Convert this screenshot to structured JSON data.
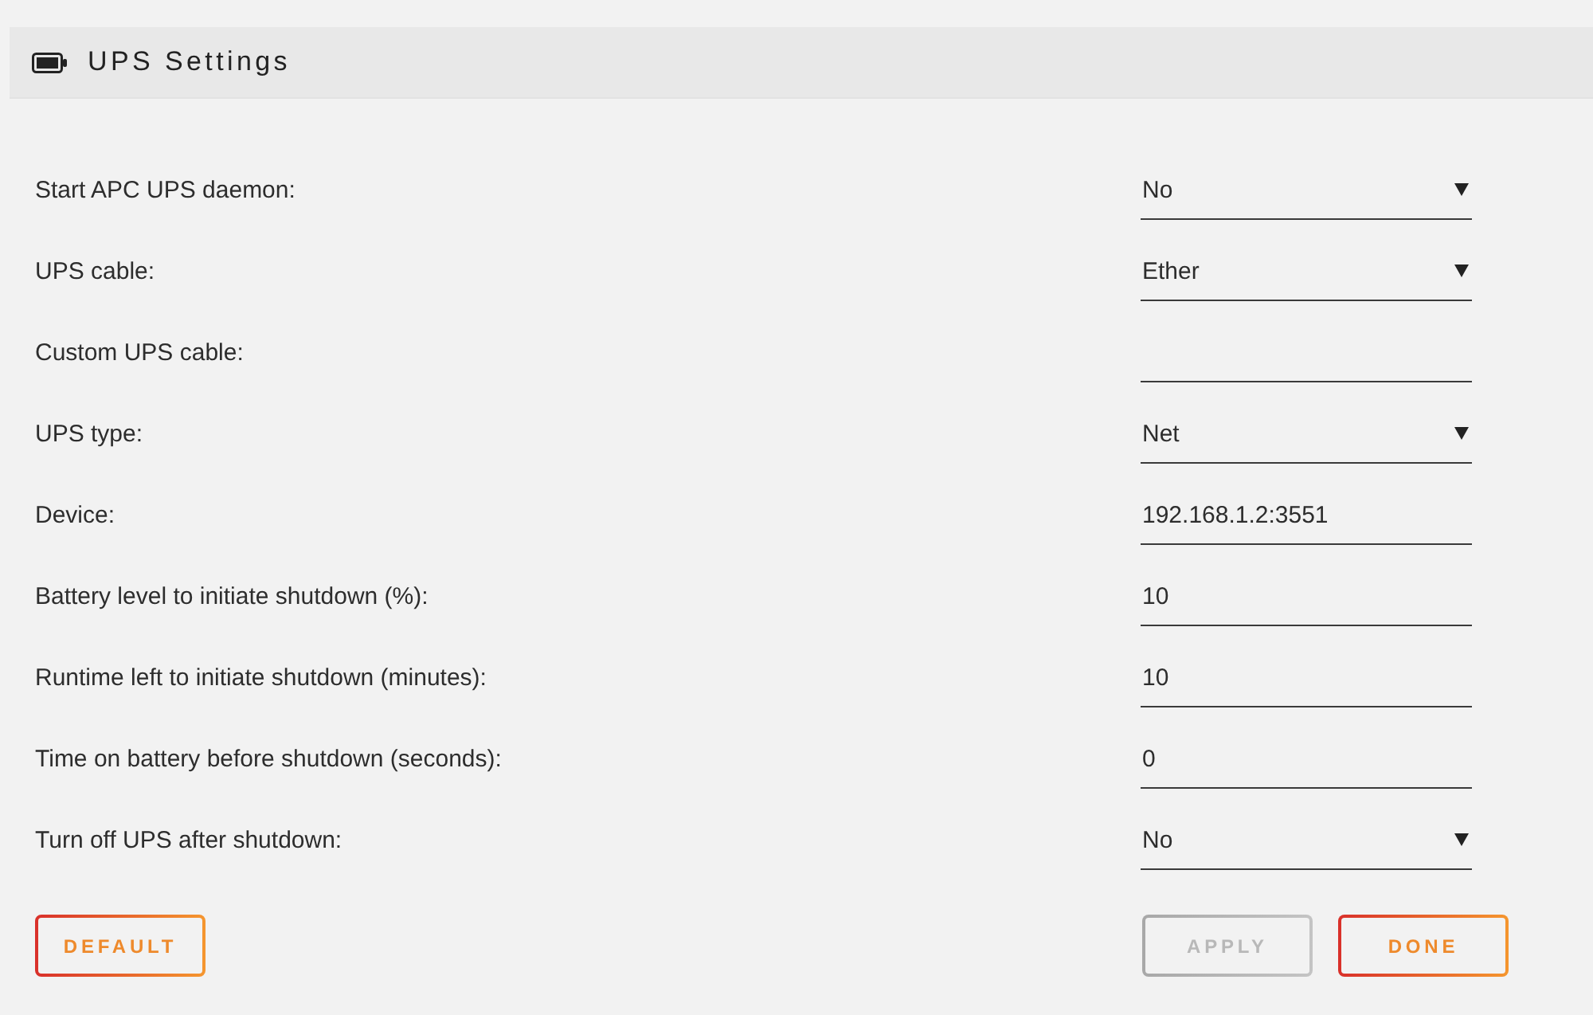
{
  "panel": {
    "title": "UPS Settings"
  },
  "settings": [
    {
      "label": "Start APC UPS daemon:",
      "kind": "select",
      "value": "No"
    },
    {
      "label": "UPS cable:",
      "kind": "select",
      "value": "Ether"
    },
    {
      "label": "Custom UPS cable:",
      "kind": "text"
    },
    {
      "label": "UPS type:",
      "kind": "select",
      "value": "Net"
    },
    {
      "label": "Device:",
      "kind": "text",
      "value": "192.168.1.2:3551"
    },
    {
      "label": "Battery level to initiate shutdown (%):",
      "kind": "text",
      "value": "10"
    },
    {
      "label": "Runtime left to initiate shutdown (minutes):",
      "kind": "text",
      "value": "10"
    },
    {
      "label": "Time on battery before shutdown (seconds):",
      "kind": "text",
      "value": "0"
    },
    {
      "label": "Turn off UPS after shutdown:",
      "kind": "select",
      "value": "No"
    }
  ],
  "footer": {
    "left_buttons": [
      {
        "label": "DEFAULT",
        "disabled": false
      }
    ],
    "right_buttons": [
      {
        "label": "APPLY",
        "disabled": true
      },
      {
        "label": "DONE",
        "disabled": false
      }
    ]
  }
}
